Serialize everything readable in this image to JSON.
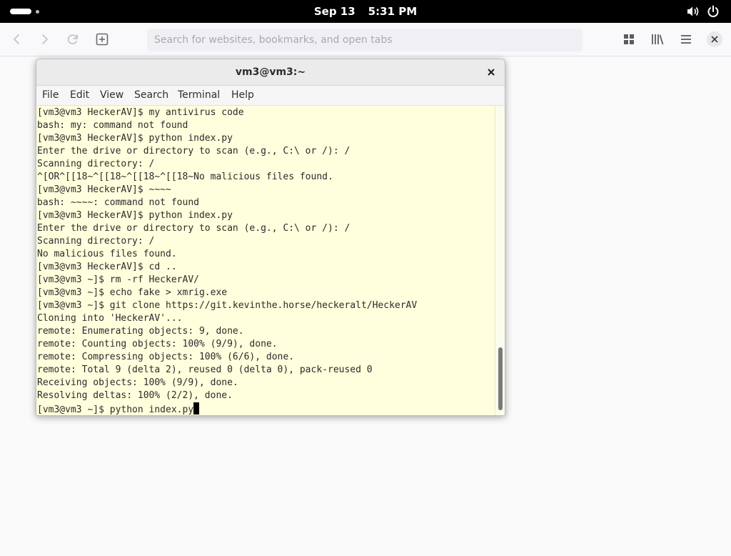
{
  "topbar": {
    "date": "Sep 13",
    "time": "5:31 PM"
  },
  "browser": {
    "search_placeholder": "Search for websites, bookmarks, and open tabs"
  },
  "terminal": {
    "title": "vm3@vm3:~",
    "menu": [
      "File",
      "Edit",
      "View",
      "Search",
      "Terminal",
      "Help"
    ],
    "lines": [
      "[vm3@vm3 HeckerAV]$ my antivirus code",
      "bash: my: command not found",
      "[vm3@vm3 HeckerAV]$ python index.py",
      "Enter the drive or directory to scan (e.g., C:\\ or /): /",
      "Scanning directory: /",
      "^[OR^[[18~^[[18~^[[18~^[[18~No malicious files found.",
      "[vm3@vm3 HeckerAV]$ ~~~~",
      "bash: ~~~~: command not found",
      "[vm3@vm3 HeckerAV]$ python index.py",
      "Enter the drive or directory to scan (e.g., C:\\ or /): /",
      "Scanning directory: /",
      "No malicious files found.",
      "[vm3@vm3 HeckerAV]$ cd ..",
      "[vm3@vm3 ~]$ rm -rf HeckerAV/",
      "[vm3@vm3 ~]$ echo fake > xmrig.exe",
      "[vm3@vm3 ~]$ git clone https://git.kevinthe.horse/heckeralt/HeckerAV",
      "Cloning into 'HeckerAV'...",
      "remote: Enumerating objects: 9, done.",
      "remote: Counting objects: 100% (9/9), done.",
      "remote: Compressing objects: 100% (6/6), done.",
      "remote: Total 9 (delta 2), reused 0 (delta 0), pack-reused 0",
      "Receiving objects: 100% (9/9), done.",
      "Resolving deltas: 100% (2/2), done.",
      "[vm3@vm3 ~]$ python index.py"
    ]
  },
  "colors": {
    "terminal_background": "#ffffdd",
    "terminal_text": "#2b2b2b",
    "topbar": "#000000"
  },
  "icons": {
    "activities": "activities-indicator-icon",
    "volume": "volume-icon",
    "power": "power-icon",
    "back": "back-arrow-icon",
    "forward": "forward-arrow-icon",
    "reload": "reload-icon",
    "new_tab": "new-tab-icon",
    "overview": "grid-icon",
    "library": "library-icon",
    "menu": "hamburger-menu-icon",
    "close": "close-icon"
  }
}
